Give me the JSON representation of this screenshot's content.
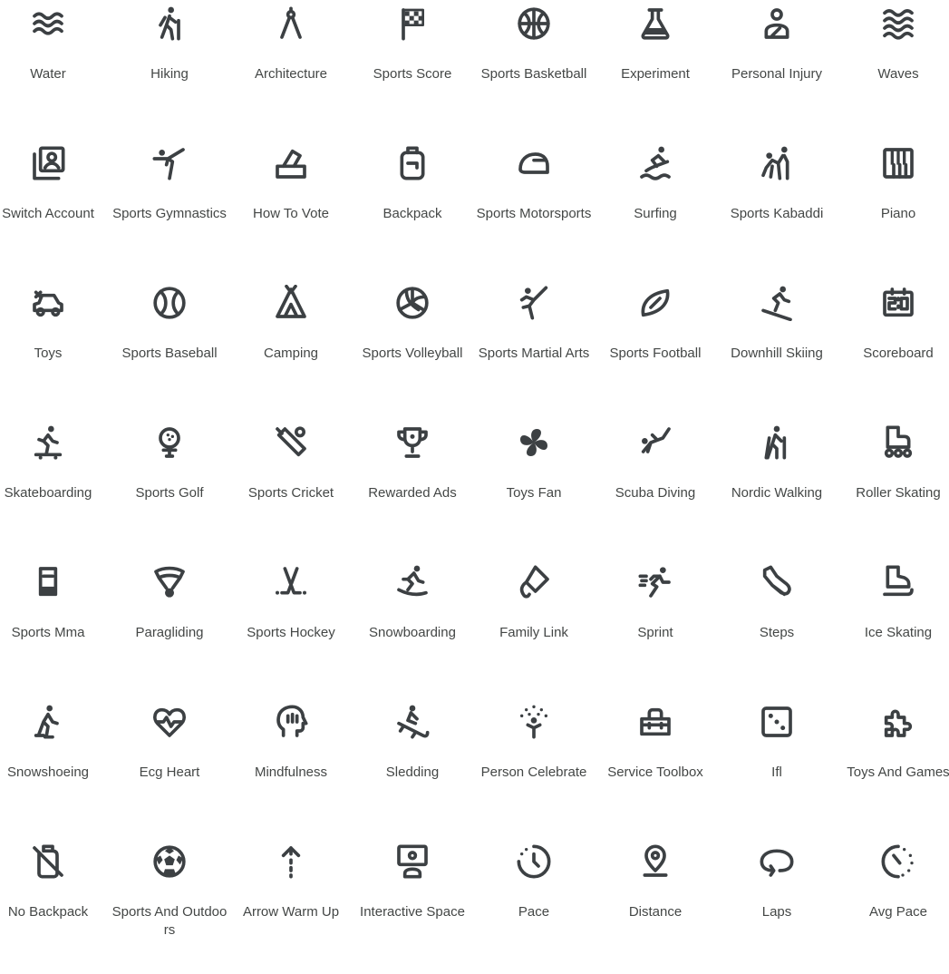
{
  "icons": [
    {
      "label": "Water",
      "icon": "water-icon"
    },
    {
      "label": "Hiking",
      "icon": "hiking-icon"
    },
    {
      "label": "Architecture",
      "icon": "architecture-icon"
    },
    {
      "label": "Sports Score",
      "icon": "sports-score-icon"
    },
    {
      "label": "Sports Basketball",
      "icon": "sports-basketball-icon"
    },
    {
      "label": "Experiment",
      "icon": "experiment-icon"
    },
    {
      "label": "Personal Injury",
      "icon": "personal-injury-icon"
    },
    {
      "label": "Waves",
      "icon": "waves-icon"
    },
    {
      "label": "Switch Account",
      "icon": "switch-account-icon"
    },
    {
      "label": "Sports Gymnastics",
      "icon": "sports-gymnastics-icon"
    },
    {
      "label": "How To Vote",
      "icon": "how-to-vote-icon"
    },
    {
      "label": "Backpack",
      "icon": "backpack-icon"
    },
    {
      "label": "Sports Motorsports",
      "icon": "sports-motorsports-icon"
    },
    {
      "label": "Surfing",
      "icon": "surfing-icon"
    },
    {
      "label": "Sports Kabaddi",
      "icon": "sports-kabaddi-icon"
    },
    {
      "label": "Piano",
      "icon": "piano-icon"
    },
    {
      "label": "Toys",
      "icon": "toys-icon"
    },
    {
      "label": "Sports Baseball",
      "icon": "sports-baseball-icon"
    },
    {
      "label": "Camping",
      "icon": "camping-icon"
    },
    {
      "label": "Sports Volleyball",
      "icon": "sports-volleyball-icon"
    },
    {
      "label": "Sports Martial Arts",
      "icon": "sports-martial-arts-icon"
    },
    {
      "label": "Sports Football",
      "icon": "sports-football-icon"
    },
    {
      "label": "Downhill Skiing",
      "icon": "downhill-skiing-icon"
    },
    {
      "label": "Scoreboard",
      "icon": "scoreboard-icon"
    },
    {
      "label": "Skateboarding",
      "icon": "skateboarding-icon"
    },
    {
      "label": "Sports Golf",
      "icon": "sports-golf-icon"
    },
    {
      "label": "Sports Cricket",
      "icon": "sports-cricket-icon"
    },
    {
      "label": "Rewarded Ads",
      "icon": "rewarded-ads-icon"
    },
    {
      "label": "Toys Fan",
      "icon": "toys-fan-icon"
    },
    {
      "label": "Scuba Diving",
      "icon": "scuba-diving-icon"
    },
    {
      "label": "Nordic Walking",
      "icon": "nordic-walking-icon"
    },
    {
      "label": "Roller Skating",
      "icon": "roller-skating-icon"
    },
    {
      "label": "Sports Mma",
      "icon": "sports-mma-icon"
    },
    {
      "label": "Paragliding",
      "icon": "paragliding-icon"
    },
    {
      "label": "Sports Hockey",
      "icon": "sports-hockey-icon"
    },
    {
      "label": "Snowboarding",
      "icon": "snowboarding-icon"
    },
    {
      "label": "Family Link",
      "icon": "family-link-icon"
    },
    {
      "label": "Sprint",
      "icon": "sprint-icon"
    },
    {
      "label": "Steps",
      "icon": "steps-icon"
    },
    {
      "label": "Ice Skating",
      "icon": "ice-skating-icon"
    },
    {
      "label": "Snowshoeing",
      "icon": "snowshoeing-icon"
    },
    {
      "label": "Ecg Heart",
      "icon": "ecg-heart-icon"
    },
    {
      "label": "Mindfulness",
      "icon": "mindfulness-icon"
    },
    {
      "label": "Sledding",
      "icon": "sledding-icon"
    },
    {
      "label": "Person Celebrate",
      "icon": "person-celebrate-icon"
    },
    {
      "label": "Service Toolbox",
      "icon": "service-toolbox-icon"
    },
    {
      "label": "Ifl",
      "icon": "ifl-icon"
    },
    {
      "label": "Toys And Games",
      "icon": "toys-and-games-icon"
    },
    {
      "label": "No Backpack",
      "icon": "no-backpack-icon"
    },
    {
      "label": "Sports And Outdoors",
      "icon": "sports-and-outdoors-icon"
    },
    {
      "label": "Arrow Warm Up",
      "icon": "arrow-warm-up-icon"
    },
    {
      "label": "Interactive Space",
      "icon": "interactive-space-icon"
    },
    {
      "label": "Pace",
      "icon": "pace-icon"
    },
    {
      "label": "Distance",
      "icon": "distance-icon"
    },
    {
      "label": "Laps",
      "icon": "laps-icon"
    },
    {
      "label": "Avg Pace",
      "icon": "avg-pace-icon"
    }
  ]
}
